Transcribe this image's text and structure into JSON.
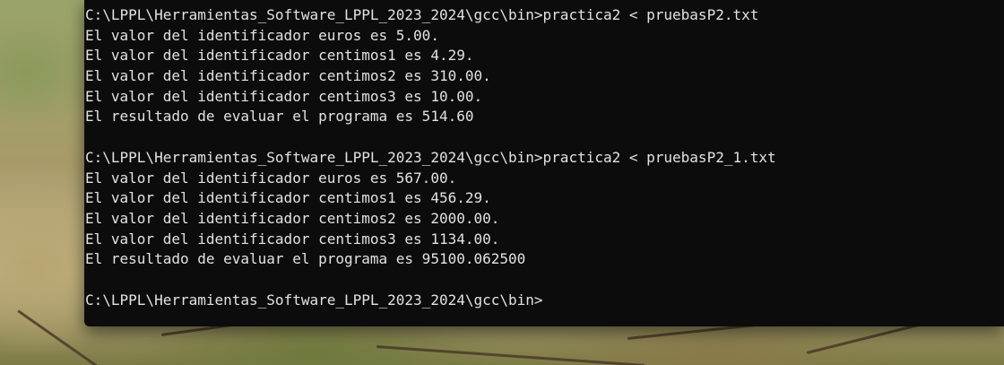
{
  "terminal": {
    "lines": [
      "C:\\LPPL\\Herramientas_Software_LPPL_2023_2024\\gcc\\bin>practica2 < pruebasP2.txt",
      "El valor del identificador euros es 5.00.",
      "El valor del identificador centimos1 es 4.29.",
      "El valor del identificador centimos2 es 310.00.",
      "El valor del identificador centimos3 es 10.00.",
      "El resultado de evaluar el programa es 514.60",
      "",
      "C:\\LPPL\\Herramientas_Software_LPPL_2023_2024\\gcc\\bin>practica2 < pruebasP2_1.txt",
      "El valor del identificador euros es 567.00.",
      "El valor del identificador centimos1 es 456.29.",
      "El valor del identificador centimos2 es 2000.00.",
      "El valor del identificador centimos3 es 1134.00.",
      "El resultado de evaluar el programa es 95100.062500",
      "",
      "C:\\LPPL\\Herramientas_Software_LPPL_2023_2024\\gcc\\bin>"
    ]
  },
  "colors": {
    "terminal_background": "#0c0c0c",
    "terminal_text": "#e2e2e2"
  }
}
